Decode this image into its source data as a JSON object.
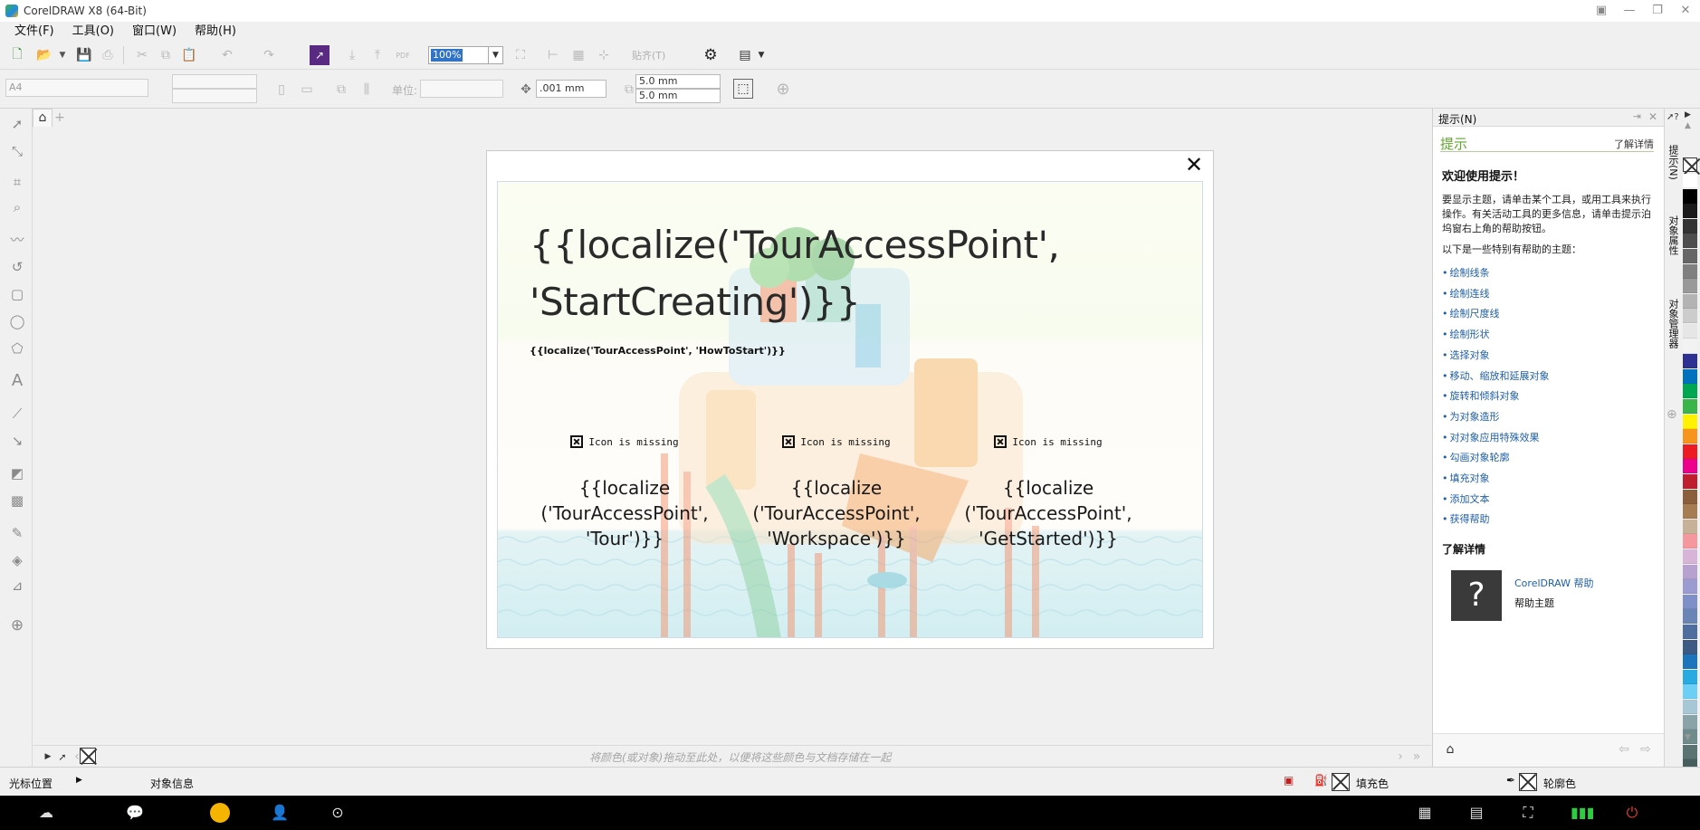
{
  "window": {
    "title": "CorelDRAW X8 (64-Bit)"
  },
  "menu": [
    "文件(F)",
    "工具(O)",
    "窗口(W)",
    "帮助(H)"
  ],
  "toolbar": {
    "zoom_value": "100%",
    "snap_label": "贴齐(T)",
    "pdf_label": "PDF"
  },
  "property_bar": {
    "page_size": "A4",
    "units_label": "单位:",
    "nudge": ".001 mm",
    "dup_x": "5.0 mm",
    "dup_y": "5.0 mm"
  },
  "dialog": {
    "title": "{{localize('TourAccessPoint', 'StartCreating')}}",
    "subtitle": "{{localize('TourAccessPoint', 'HowToStart')}}",
    "close_glyph": "✕",
    "cards": [
      {
        "icon_text": "Icon is missing",
        "label": "{{localize\n('TourAccessPoint',\n'Tour')}}"
      },
      {
        "icon_text": "Icon is missing",
        "label": "{{localize\n('TourAccessPoint',\n'Workspace')}}"
      },
      {
        "icon_text": "Icon is missing",
        "label": "{{localize\n('TourAccessPoint',\n'GetStarted')}}"
      }
    ]
  },
  "canvas": {
    "drop_hint": "将颜色(或对象)拖动至此处，以便将这些颜色与文档存储在一起"
  },
  "docker": {
    "header": "提示(N)",
    "section_title": "提示",
    "learn_more_link": "了解详情",
    "welcome": "欢迎使用提示！",
    "intro": "要显示主题，请单击某个工具，或用工具来执行操作。有关活动工具的更多信息，请单击提示泊坞窗右上角的帮助按钮。",
    "topics_intro": "以下是一些特别有帮助的主题：",
    "topics": [
      "绘制线条",
      "绘制连线",
      "绘制尺度线",
      "绘制形状",
      "选择对象",
      "移动、缩放和延展对象",
      "旋转和倾斜对象",
      "为对象造形",
      "对对象应用特殊效果",
      "勾画对象轮廓",
      "填充对象",
      "添加文本",
      "获得帮助"
    ],
    "learn_more_heading": "了解详情",
    "help_title": "CorelDRAW 帮助",
    "help_sub": "帮助主题",
    "help_glyph": "?"
  },
  "side_tabs": [
    "提示(N)",
    "对象属性",
    "对象管理器"
  ],
  "palette_colors": [
    "#ffffff",
    "#000000",
    "#1a1a1a",
    "#333333",
    "#4d4d4d",
    "#666666",
    "#808080",
    "#999999",
    "#b3b3b3",
    "#cccccc",
    "#e6e6e6",
    "#f2f2f2",
    "#2e3192",
    "#0071bc",
    "#00a651",
    "#39b54a",
    "#fff200",
    "#f7941d",
    "#ed1c24",
    "#ec008c",
    "#be1e2d",
    "#8b5e3c",
    "#a67c52",
    "#c7b299",
    "#f5989d",
    "#d7b4d8",
    "#b7a2cf",
    "#9b9bd1",
    "#7f8fc7",
    "#6b84b6",
    "#4f6e9f",
    "#3c5a84",
    "#1c75bc",
    "#29abe2",
    "#6dcff6",
    "#a7c7d6",
    "#8aa3a8",
    "#6f8b8c",
    "#5a7474",
    "#465e5e"
  ],
  "status": {
    "cursor_pos": "光标位置",
    "obj_info": "对象信息",
    "fill_label": "填充色",
    "outline_label": "轮廓色"
  }
}
